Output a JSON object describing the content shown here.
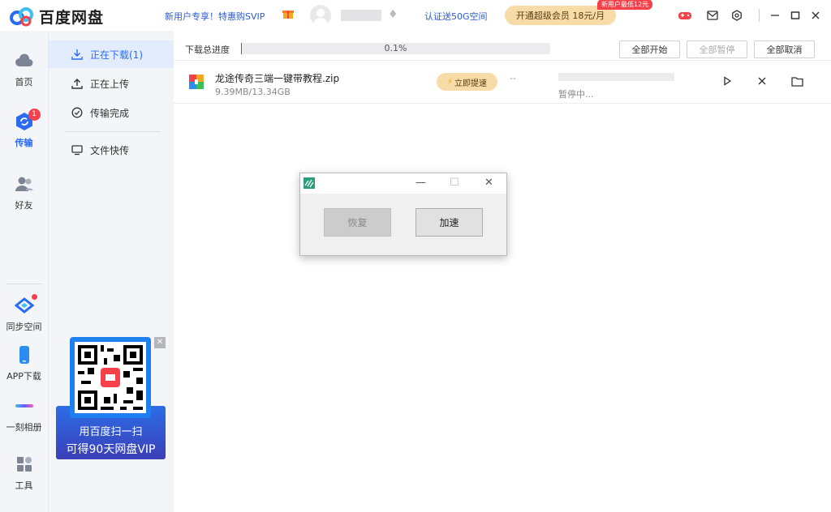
{
  "topbar": {
    "app_name": "百度网盘",
    "promo_text": "新用户专享！特惠购SVIP",
    "verify_text": "认证送50G空间",
    "vip_button": "开通超级会员 18元/月",
    "vip_badge": "新用户最低12元",
    "icons": [
      "game-icon",
      "mail-icon",
      "settings-icon",
      "minimize-icon",
      "maximize-icon",
      "close-icon"
    ]
  },
  "rail": {
    "items": [
      {
        "label": "首页",
        "icon": "cloud-icon"
      },
      {
        "label": "传输",
        "icon": "transfer-icon",
        "badge": "1"
      },
      {
        "label": "好友",
        "icon": "friends-icon"
      },
      {
        "label": "同步空间",
        "icon": "sync-icon"
      },
      {
        "label": "APP下载",
        "icon": "phone-icon"
      },
      {
        "label": "一刻相册",
        "icon": "album-icon"
      },
      {
        "label": "工具",
        "icon": "tools-icon"
      }
    ]
  },
  "subnav": {
    "items": [
      {
        "label": "正在下载(1)",
        "icon": "download-icon"
      },
      {
        "label": "正在上传",
        "icon": "upload-icon"
      },
      {
        "label": "传输完成",
        "icon": "check-icon"
      },
      {
        "label": "文件快传",
        "icon": "monitor-icon"
      }
    ]
  },
  "qr_promo": {
    "line1": "用百度扫一扫",
    "line2": "可得90天网盘VIP"
  },
  "download": {
    "total_label": "下载总进度",
    "total_percent": "0.1%",
    "total_progress": 0.001,
    "buttons": {
      "start_all": "全部开始",
      "pause_all": "全部暂停",
      "cancel_all": "全部取消"
    }
  },
  "task": {
    "file_name": "龙途传奇三端一键带教程.zip",
    "file_size": "9.39MB/13.34GB",
    "speed_button": "立即提速",
    "speed": "--",
    "status": "暂停中..."
  },
  "dialog": {
    "resume_button": "恢复",
    "accelerate_button": "加速"
  },
  "colors": {
    "accent": "#2a6bf2",
    "vip_gold": "#f8dca8",
    "badge_red": "#f5424a"
  }
}
